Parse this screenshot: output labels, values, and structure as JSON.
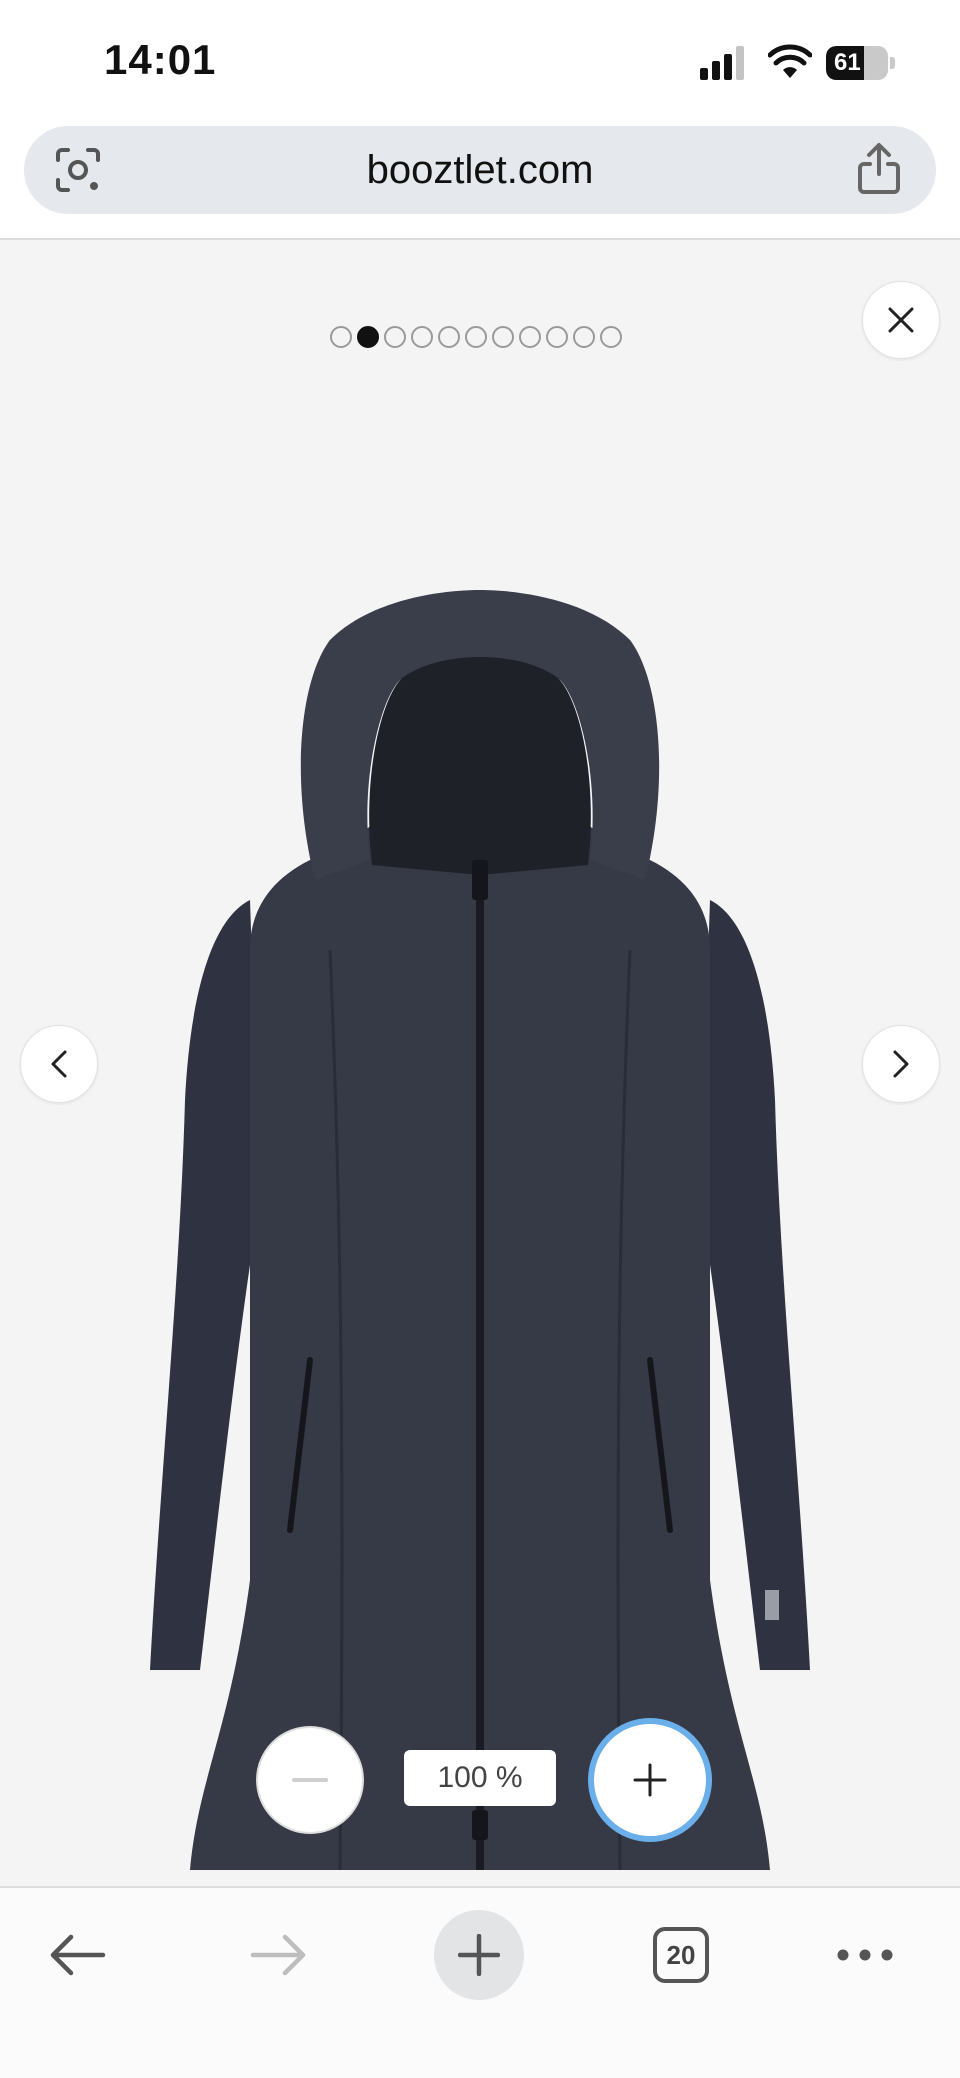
{
  "status_bar": {
    "time": "14:01",
    "battery_level": "61",
    "battery_fraction": 0.61,
    "icons": [
      "cellular-signal-icon",
      "wifi-icon",
      "battery-icon"
    ]
  },
  "browser": {
    "url": "booztlet.com",
    "icons": [
      "google-lens-icon",
      "share-icon"
    ]
  },
  "gallery": {
    "page_count": 11,
    "active_page_index": 1,
    "product_image": "dark navy hooded softshell rain coat",
    "icons": [
      "close-icon",
      "chevron-left-icon",
      "chevron-right-icon"
    ],
    "zoom": {
      "level_label": "100 %",
      "icons": [
        "minus-icon",
        "plus-icon"
      ]
    }
  },
  "toolbar": {
    "tab_count": "20",
    "icons": [
      "back-arrow-icon",
      "forward-arrow-icon",
      "new-tab-icon",
      "tabs-icon",
      "more-icon"
    ]
  },
  "colors": {
    "accent_zoom_ring": "#6aaeea",
    "coat": "#363946",
    "background": "#f4f4f4"
  }
}
